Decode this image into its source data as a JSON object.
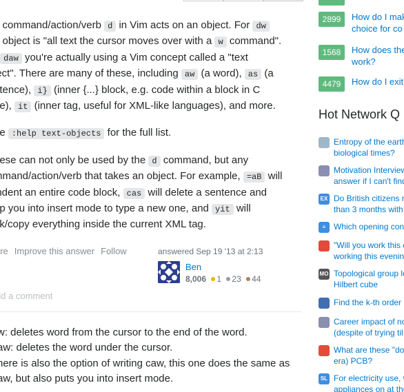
{
  "answer": {
    "paragraphs": [
      {
        "parts": [
          "e command/action/verb ",
          {
            "code": "d"
          },
          " in Vim acts on an object. For ",
          {
            "code": "dw"
          },
          "\ne object is \"all text the cursor moves over with a ",
          {
            "code": "w"
          },
          " command\".\nr ",
          {
            "code": "daw"
          },
          " you're actually using a Vim concept called a \"text\nject\". There are many of these, including ",
          {
            "code": "aw"
          },
          " (a word), ",
          {
            "code": "as"
          },
          " (a\nntence), ",
          {
            "code": "i}"
          },
          " (inner {...} block, e.g. code within a block in C\nde), ",
          {
            "code": "it"
          },
          " (inner tag, useful for XML-like languages), and more."
        ]
      },
      {
        "parts": [
          "ee ",
          {
            "code": ":help text-objects"
          },
          " for the full list."
        ]
      },
      {
        "parts": [
          "hese can not only be used by the ",
          {
            "code": "d"
          },
          " command, but any\nmmand/action/verb that takes an object. For example, ",
          {
            "code": "=aB"
          },
          " will\nindent an entire code block, ",
          {
            "code": "cas"
          },
          " will delete a sentence and\nop you into insert mode to type a new one, and ",
          {
            "code": "yit"
          },
          " will\nnk/copy everything inside the current XML tag."
        ]
      }
    ],
    "menu": [
      "are",
      "Improve this answer",
      "Follow"
    ],
    "answered_label": "answered Sep 19 '13 at 2:13",
    "user_name": "Ben",
    "user_rep": "8,006",
    "badge_gold": "1",
    "badge_silver": "23",
    "badge_bronze": "44",
    "add_comment": "dd a comment",
    "comments": [
      "w: deletes word from the cursor to the end of the word.",
      "aw: deletes the word under the cursor.",
      "here is also the option of writing caw, this one does the same as",
      "aw, but also puts you into insert mode."
    ]
  },
  "linked": [
    {
      "score": "2899",
      "title": "How do I mak\nchoice for co"
    },
    {
      "score": "1568",
      "title": "How does the\nwork?"
    },
    {
      "score": "4479",
      "title": "How do I exit"
    }
  ],
  "hnq": {
    "title": "Hot Network Q",
    "items": [
      {
        "icon": "earth-science-icon",
        "color": "#9fb7c9",
        "glyph": "",
        "text": "Entropy of the earth\nbiological times?"
      },
      {
        "icon": "books-icon",
        "color": "#8a8fb0",
        "glyph": "",
        "text": "Motivation Interview\nanswer if I can't find"
      },
      {
        "icon": "expatriates-icon",
        "color": "#3f8ee0",
        "glyph": "EX",
        "text": "Do British citizens n\nthan 3 months with"
      },
      {
        "icon": "writing-icon",
        "color": "#3f8ee0",
        "glyph": "≡",
        "text": "Which opening con"
      },
      {
        "icon": "bookmark-icon",
        "color": "#e24a3a",
        "glyph": "",
        "text": "\"Will you work this e\nworking this evenin"
      },
      {
        "icon": "mathoverflow-icon",
        "color": "#555555",
        "glyph": "MO",
        "text": "Topological group lo\nHilbert cube"
      },
      {
        "icon": "medal-icon",
        "color": "#3f6fb0",
        "glyph": "",
        "text": "Find the k-th order"
      },
      {
        "icon": "books-icon",
        "color": "#8a8fb0",
        "glyph": "",
        "text": "Career impact of no\n(despite of trying til"
      },
      {
        "icon": "retrocomputing-icon",
        "color": "#e24a3a",
        "glyph": "",
        "text": "What are these \"do\nera) PCB?"
      },
      {
        "icon": "sustainable-living-icon",
        "color": "#3f8ee0",
        "glyph": "SL",
        "text": "For electricity use, w\nappliances on at the"
      }
    ]
  }
}
